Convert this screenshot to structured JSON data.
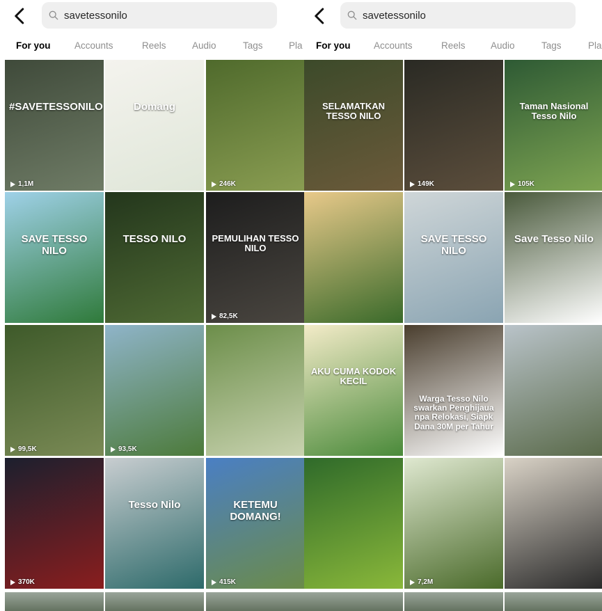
{
  "search": {
    "query": "savetessonilo"
  },
  "tabs_left": [
    "For you",
    "Accounts",
    "Reels",
    "Audio",
    "Tags",
    "Pla"
  ],
  "tabs_right": [
    "For you",
    "Accounts",
    "Reels",
    "Audio",
    "Tags",
    "Pla"
  ],
  "active_tab": "For you",
  "grid_left": [
    {
      "caption": "#SAVETESSONILO",
      "views": "1,1M",
      "colors": [
        "#3f4a3a",
        "#6f7c66"
      ]
    },
    {
      "caption": "Domang",
      "views": "",
      "colors": [
        "#f4f3ee",
        "#dfe6d8"
      ]
    },
    {
      "caption": "",
      "views": "246K",
      "colors": [
        "#4f6a2c",
        "#8a9d52"
      ]
    },
    {
      "caption": "SAVE TESSO NILO",
      "views": "",
      "colors": [
        "#9fd1e8",
        "#2f7a3a"
      ]
    },
    {
      "caption": "TESSO NILO",
      "views": "",
      "colors": [
        "#23361c",
        "#4f6a34"
      ]
    },
    {
      "caption": "PEMULIHAN TESSO NILO",
      "views": "82,5K",
      "colors": [
        "#1d1d1d",
        "#4a4640"
      ]
    },
    {
      "caption": "",
      "views": "99,5K",
      "colors": [
        "#3e5a2a",
        "#7a8a55"
      ]
    },
    {
      "caption": "",
      "views": "93,5K",
      "colors": [
        "#8fb4c9",
        "#4c7a3a"
      ]
    },
    {
      "caption": "",
      "views": "",
      "colors": [
        "#6c8e4a",
        "#c9d3b0"
      ]
    },
    {
      "caption": "",
      "views": "370K",
      "colors": [
        "#1c1f2e",
        "#8a1e1e"
      ]
    },
    {
      "caption": "Tesso Nilo",
      "views": "",
      "colors": [
        "#c8cdd0",
        "#2d6a6a"
      ]
    },
    {
      "caption": "KETEMU DOMANG!",
      "views": "415K",
      "colors": [
        "#4a7fc4",
        "#6b8b4a"
      ]
    }
  ],
  "grid_right": [
    {
      "caption": "SELAMATKAN TESSO NILO",
      "views": "",
      "colors": [
        "#3c4a2a",
        "#6b5a3a"
      ]
    },
    {
      "caption": "",
      "views": "149K",
      "colors": [
        "#2a2a24",
        "#5c4e3c"
      ]
    },
    {
      "caption": "Taman Nasional Tesso Nilo",
      "views": "105K",
      "colors": [
        "#2e5a34",
        "#7ea452"
      ]
    },
    {
      "caption": "",
      "views": "",
      "colors": [
        "#e8c98a",
        "#3a6a2a"
      ]
    },
    {
      "caption": "SAVE TESSO NILO",
      "views": "",
      "colors": [
        "#cfd6d8",
        "#8aa4b2"
      ]
    },
    {
      "caption": "Save Tesso Nilo",
      "views": "",
      "colors": [
        "#4a5a3c",
        "#ffffff"
      ]
    },
    {
      "caption": "AKU CUMA KODOK KECIL",
      "views": "",
      "colors": [
        "#f3ebc8",
        "#4a8a3a"
      ]
    },
    {
      "caption": "Warga Tesso Nilo swarkan Penghijaua npa Relokasi, Siapk Dana 30M per Tahur",
      "views": "",
      "colors": [
        "#4a3e2e",
        "#ffffff"
      ]
    },
    {
      "caption": "",
      "views": "",
      "colors": [
        "#b9c3c9",
        "#5a6a4a"
      ]
    },
    {
      "caption": "",
      "views": "",
      "colors": [
        "#2f6a2a",
        "#8ab83a"
      ]
    },
    {
      "caption": "",
      "views": "7,2M",
      "colors": [
        "#dfe8d0",
        "#4a6a2a"
      ]
    },
    {
      "caption": "",
      "views": "",
      "colors": [
        "#d9d2c6",
        "#2a2a2a"
      ]
    }
  ]
}
